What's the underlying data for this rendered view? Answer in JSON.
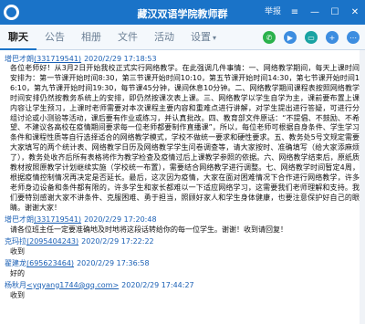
{
  "window": {
    "title": "藏汉双语学院教师群",
    "controls": {
      "report": "举报"
    }
  },
  "tabs": [
    {
      "label": "聊天",
      "active": true
    },
    {
      "label": "公告",
      "active": false
    },
    {
      "label": "相册",
      "active": false
    },
    {
      "label": "文件",
      "active": false
    },
    {
      "label": "活动",
      "active": false
    },
    {
      "label": "设置",
      "active": false
    }
  ],
  "messages": [
    {
      "sender": "增巴才朗",
      "qq": "(331719541)",
      "time": "2020/2/29 17:18:53",
      "text": "各位老师好！从3月2日开始我校正式实行网络教学。在此强调几件事情：一、网络教学期间，每天上课时间安排为：第一节课开始时间8:30，第三节课开始时间10:10，第五节课开始时间14:30，第七节课开始时间16:10，第九节课开始时间19:30，每节课45分钟，课间休息10分钟。二、网络教学期间课程表按照网络教学时间安排仍然按教务系统上的安排，即仍然按课次表上课。三、网络教学以学生自学为主，课前要布置上课内容让学生预习，上课时老师需要对本次课程主要内容和重难点进行讲解，对学生提出进行答疑，可进行分组讨论或小测验等活动，课后要有作业或练习，并认真批改。四、教育部文件原话：“不提倡、不鼓励、不希望、不建议各高校在疫情期间要求每一位老师都要制作直播课”，所以，每位老师可根据自身条件、学生学习条件和课程性质等自行选择适合的网络教学模式，学校不做统一要求和硬性要求。五、教务处5号文规定需要大家填写的两个统计表、网络教学日历及网络教学学生问卷调查等，请大家按时、准确填写（给大家添麻烦了），教务处收齐后所有表格将作为教学检查及疫情过后上课教学参照的依据。六、网络教学结束后，原纸质教材按照原教学计划继续实施（学校统一布置），需要结合网络教学进行调整。七、网络教学时间暂定4周，根据疫情控制情况再决定是否延长。最后，这次因为疫情，大家在面对困难情况下合作进行网络教学，许多老师身边设备和条件都有限的，许多学生和家长都难以一下适应网络学习，这需要我们老师理解和支持。我们要特别感谢大家不讲条件、克服困难、勇于担当，照顾好家人和学生身体健康，也要注意保护好自己的眼睛。谢谢大家！"
    },
    {
      "sender": "增巴才朗",
      "qq": "(331719541)",
      "time": "2020/2/29 17:20:48",
      "text": "请各位班主任一定要准确地及时地将这段话转给你的每一位学生。谢谢！收到请回复！"
    },
    {
      "sender": "克玛拉",
      "qq": "(2095404243)",
      "time": "2020/2/29 17:22:22",
      "text": "收到"
    },
    {
      "sender": "翟建龙",
      "qq": "(695623464)",
      "time": "2020/2/29 17:36:58",
      "text": "好的"
    },
    {
      "sender": "杨秋月",
      "qq": "<yqyang1744@qq.com>",
      "time": "2020/2/29 17:44:27",
      "text": "收到"
    }
  ],
  "colors": {
    "titlebar": "#1a73c8",
    "link": "#1a5fb4",
    "icon_green": "#2bb24c",
    "icon_blue": "#3d8de0",
    "icon_teal": "#1aa3a3"
  }
}
